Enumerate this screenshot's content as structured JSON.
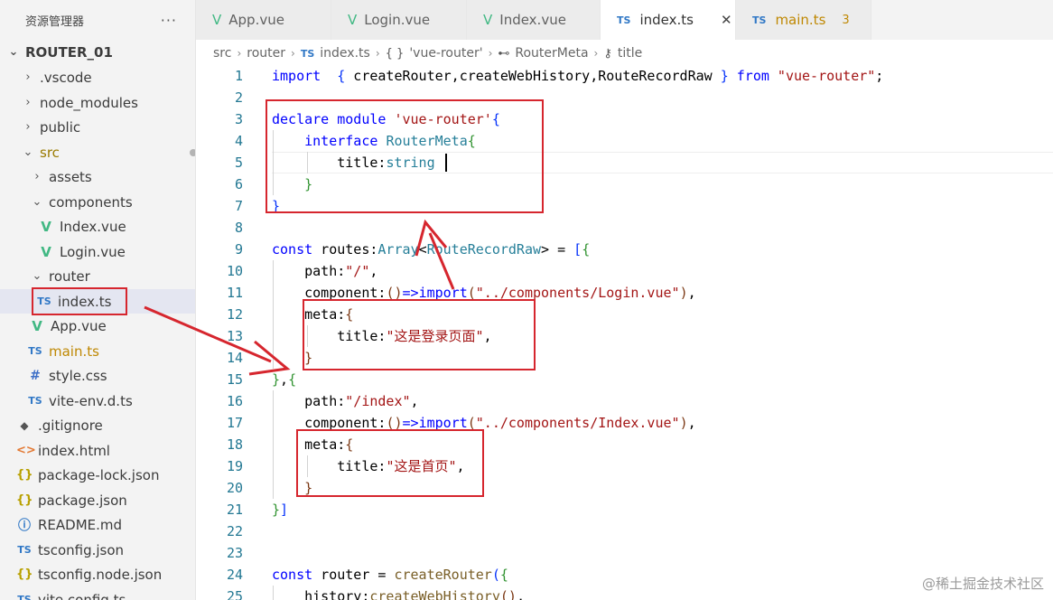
{
  "sidebar": {
    "title": "资源管理器",
    "more": "···",
    "project": "ROUTER_01",
    "items": [
      {
        "label": ".vscode",
        "chev": "›",
        "icon": ""
      },
      {
        "label": "node_modules",
        "chev": "›",
        "icon": ""
      },
      {
        "label": "public",
        "chev": "›",
        "icon": ""
      },
      {
        "label": "src",
        "chev": "⌄",
        "icon": ""
      },
      {
        "label": "assets",
        "chev": "›",
        "icon": ""
      },
      {
        "label": "components",
        "chev": "⌄",
        "icon": ""
      },
      {
        "label": "Index.vue",
        "icon": "V"
      },
      {
        "label": "Login.vue",
        "icon": "V"
      },
      {
        "label": "router",
        "chev": "⌄",
        "icon": ""
      },
      {
        "label": "index.ts",
        "icon": "TS"
      },
      {
        "label": "App.vue",
        "icon": "V"
      },
      {
        "label": "main.ts",
        "icon": "TS",
        "badge": "3"
      },
      {
        "label": "style.css",
        "icon": "#"
      },
      {
        "label": "vite-env.d.ts",
        "icon": "TS"
      },
      {
        "label": ".gitignore",
        "icon": "◆"
      },
      {
        "label": "index.html",
        "icon": "<>"
      },
      {
        "label": "package-lock.json",
        "icon": "{}"
      },
      {
        "label": "package.json",
        "icon": "{}"
      },
      {
        "label": "README.md",
        "icon": "ⓘ"
      },
      {
        "label": "tsconfig.json",
        "icon": "TS"
      },
      {
        "label": "tsconfig.node.json",
        "icon": "{}"
      },
      {
        "label": "vite.config.ts",
        "icon": "TS"
      }
    ]
  },
  "tabs": [
    {
      "label": "App.vue",
      "icon": "V"
    },
    {
      "label": "Login.vue",
      "icon": "V"
    },
    {
      "label": "Index.vue",
      "icon": "V"
    },
    {
      "label": "index.ts",
      "icon": "TS",
      "close": "✕"
    },
    {
      "label": "main.ts",
      "icon": "TS",
      "count": "3"
    }
  ],
  "breadcrumb": [
    "src",
    "router",
    "index.ts",
    "'vue-router'",
    "RouterMeta",
    "title"
  ],
  "breadcrumb_icons": {
    "ts": "TS",
    "braces": "{ }",
    "iface": "⊷",
    "key": "⚷"
  },
  "code": {
    "line_numbers": [
      "1",
      "2",
      "3",
      "4",
      "5",
      "6",
      "7",
      "8",
      "9",
      "10",
      "11",
      "12",
      "13",
      "14",
      "15",
      "16",
      "17",
      "18",
      "19",
      "20",
      "21",
      "22",
      "23",
      "24",
      "25"
    ]
  },
  "watermark": "@稀土掘金技术社区",
  "colors": {
    "accent": "#d6262e",
    "keyword": "#0000ff",
    "string": "#a31515",
    "type": "#267f99"
  }
}
